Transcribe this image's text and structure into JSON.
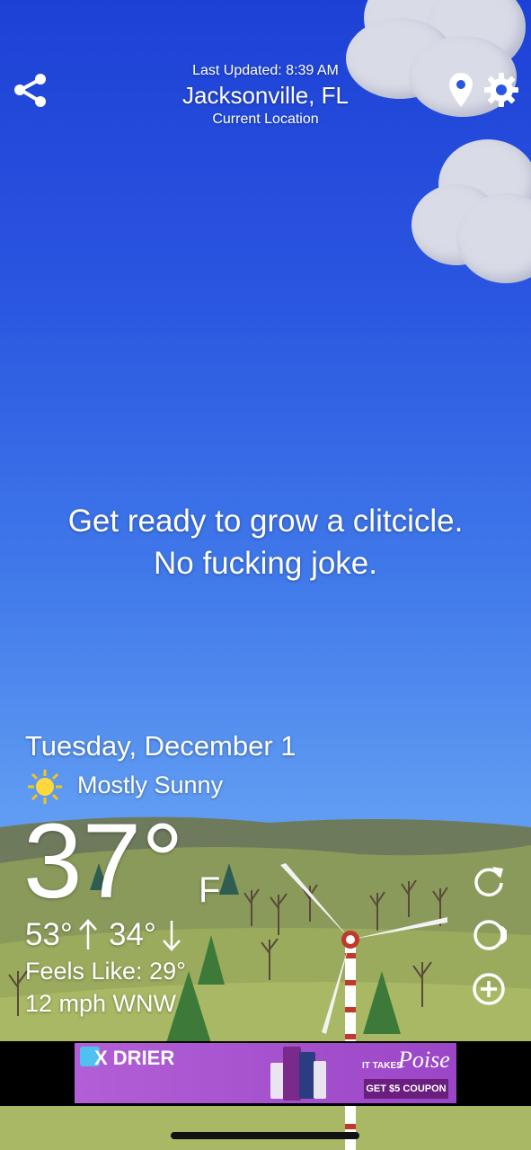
{
  "header": {
    "last_updated": "Last Updated: 8:39 AM",
    "city": "Jacksonville, FL",
    "location_label": "Current Location"
  },
  "message": {
    "line1": "Get ready to grow a clitcicle.",
    "line2": "No fucking joke."
  },
  "forecast": {
    "date": "Tuesday, December 1",
    "condition": "Mostly Sunny",
    "temperature": "37°",
    "unit": "F",
    "high": "53°",
    "low": "34°",
    "feels_like": "Feels Like: 29°",
    "wind": "12 mph WNW"
  },
  "ad": {
    "headline": "X DRIER",
    "tagline_small": "IT TAKES",
    "brand": "Poise",
    "cta": "GET $5 COUPON"
  },
  "icons": {
    "share": "share-icon",
    "location": "location-pin-icon",
    "settings": "gear-icon",
    "refresh": "refresh-icon",
    "theme": "theme-icon",
    "add": "add-icon",
    "sun": "sun-icon"
  },
  "colors": {
    "sky_top": "#1d41d6",
    "sky_bottom": "#76b3f8",
    "ad_background": "#a650cf"
  }
}
